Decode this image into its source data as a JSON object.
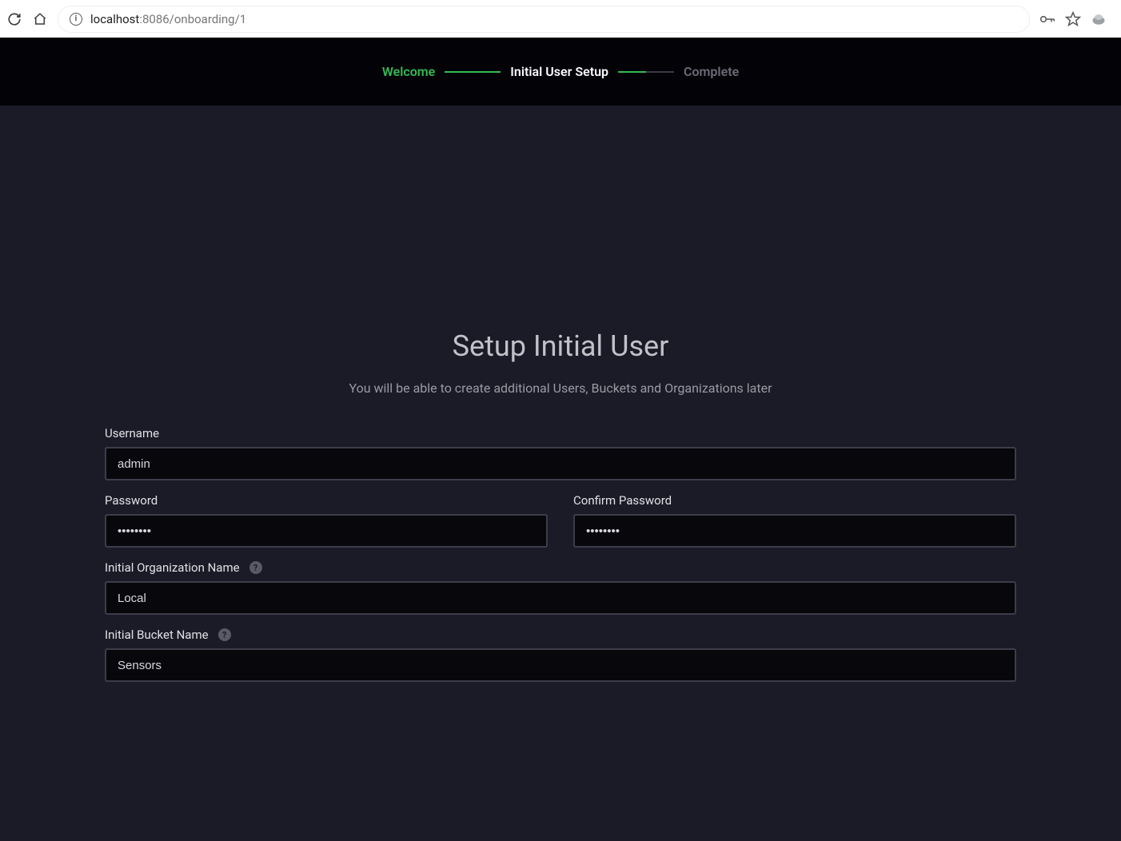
{
  "browser": {
    "url_host": "localhost",
    "url_path": ":8086/onboarding/1"
  },
  "steps": {
    "welcome": "Welcome",
    "setup": "Initial User Setup",
    "complete": "Complete"
  },
  "page": {
    "title": "Setup Initial User",
    "subtitle": "You will be able to create additional Users, Buckets and Organizations later"
  },
  "form": {
    "username_label": "Username",
    "username_value": "admin",
    "password_label": "Password",
    "password_value": "••••••••",
    "confirm_password_label": "Confirm Password",
    "confirm_password_value": "••••••••",
    "org_label": "Initial Organization Name",
    "org_value": "Local",
    "bucket_label": "Initial Bucket Name",
    "bucket_value": "Sensors",
    "help_glyph": "?"
  }
}
